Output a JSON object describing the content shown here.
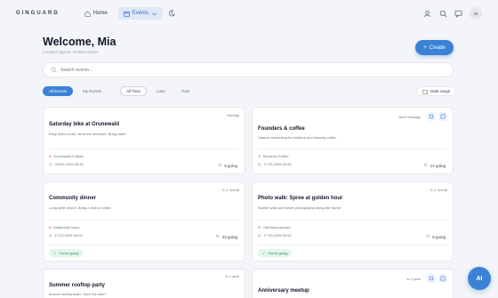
{
  "app": {
    "logo": "GINGUARD"
  },
  "nav": {
    "home": "Home",
    "events": "Events"
  },
  "user": {
    "initials": "M"
  },
  "header": {
    "welcome": "Welcome, Mia",
    "location": "Located approx. Tucked viewer"
  },
  "create_label": "Create",
  "search": {
    "placeholder": "Search events..."
  },
  "filters": {
    "scope": [
      "All Events",
      "My Events"
    ],
    "when": [
      "All Time",
      "Later",
      "Past"
    ],
    "date_range": "Date range"
  },
  "events": [
    {
      "title": "Saturday bike at Grunewald",
      "desc": "Easy 30km route, all levels welcome. Bring water.",
      "time": "Sunday",
      "location": "Grunewald S-Bahn",
      "datetime": "3/3/26 2026 08:15",
      "going": "9 going",
      "badge": ""
    },
    {
      "title": "Founders & coffee",
      "desc": "Casual networking for builders and security coffee",
      "time": "Next Tuesday",
      "location": "Bonanza Coffee",
      "datetime": "17.03.2026 09:00",
      "going": "14 going",
      "badge": ""
    },
    {
      "title": "Community dinner",
      "desc": "Long table dinner. Bring a dish to share.",
      "time": "in 1 month",
      "location": "Markthalle Neun",
      "datetime": "17.03.2026 08:00",
      "going": "22 going",
      "badge": "You're going"
    },
    {
      "title": "Photo walk: Spree at golden hour",
      "desc": "Sunset walk and street photography along the Spree",
      "time": "in 1 month",
      "location": "Oberbaumbrücke",
      "datetime": "17.03.2026 09:00",
      "going": "8 going",
      "badge": "You're going"
    },
    {
      "title": "Summer rooftop party",
      "desc": "Annual rooftop bash. Save the date!",
      "time": "in 1 year",
      "location": "",
      "datetime": "",
      "going": "",
      "badge": ""
    },
    {
      "title": "Anniversary meetup",
      "desc": "",
      "time": "in 1 year",
      "location": "",
      "datetime": "",
      "going": "",
      "badge": ""
    }
  ],
  "ai_label": "AI"
}
